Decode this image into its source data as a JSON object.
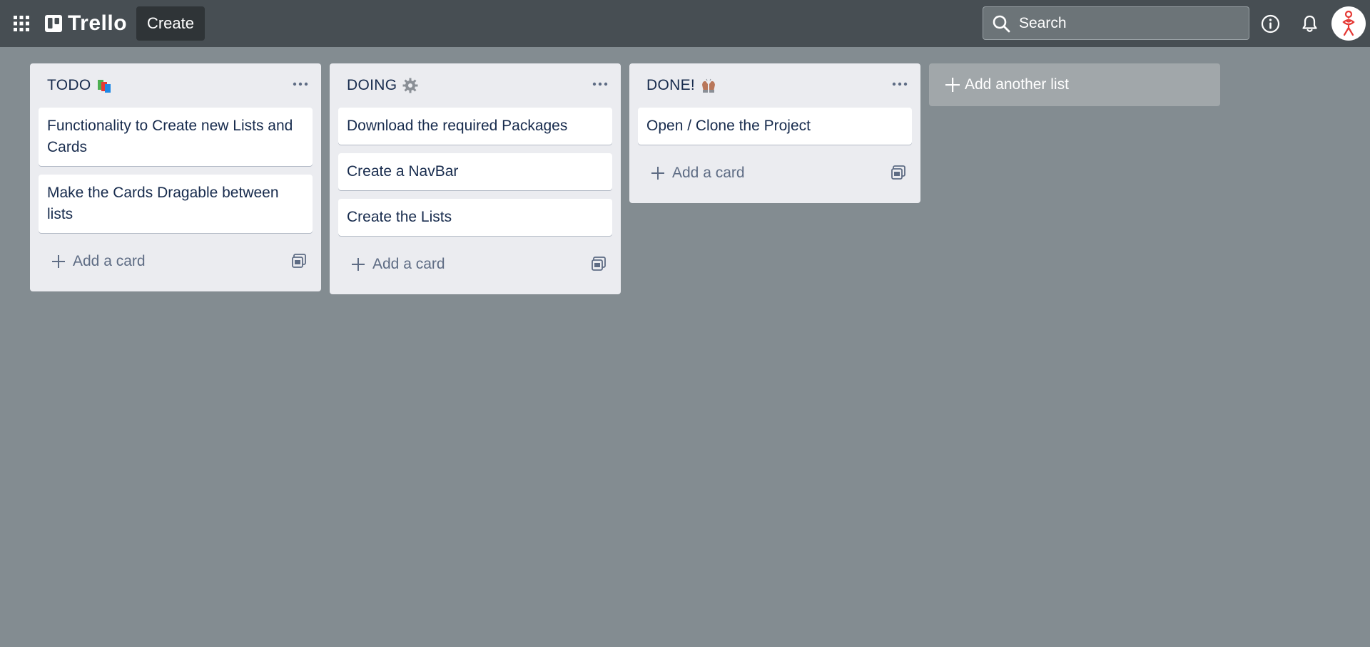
{
  "header": {
    "app_name": "Trello",
    "create_label": "Create",
    "search_placeholder": "Search"
  },
  "lists": [
    {
      "title": "TODO",
      "emoji": "books",
      "cards": [
        "Functionality to Create new Lists and Cards",
        "Make the Cards Dragable between lists"
      ],
      "add_card_label": "Add a card"
    },
    {
      "title": "DOING",
      "emoji": "gear",
      "cards": [
        "Download the required Packages",
        "Create a NavBar",
        "Create the Lists"
      ],
      "add_card_label": "Add a card"
    },
    {
      "title": "DONE!",
      "emoji": "raised-hands",
      "cards": [
        "Open / Clone the Project"
      ],
      "add_card_label": "Add a card"
    }
  ],
  "add_list_label": "Add another list",
  "colors": {
    "board_background": "#838c91",
    "header_background": "#474e53",
    "list_background": "#ebecf0",
    "card_background": "#ffffff",
    "text": "#172b4d"
  }
}
